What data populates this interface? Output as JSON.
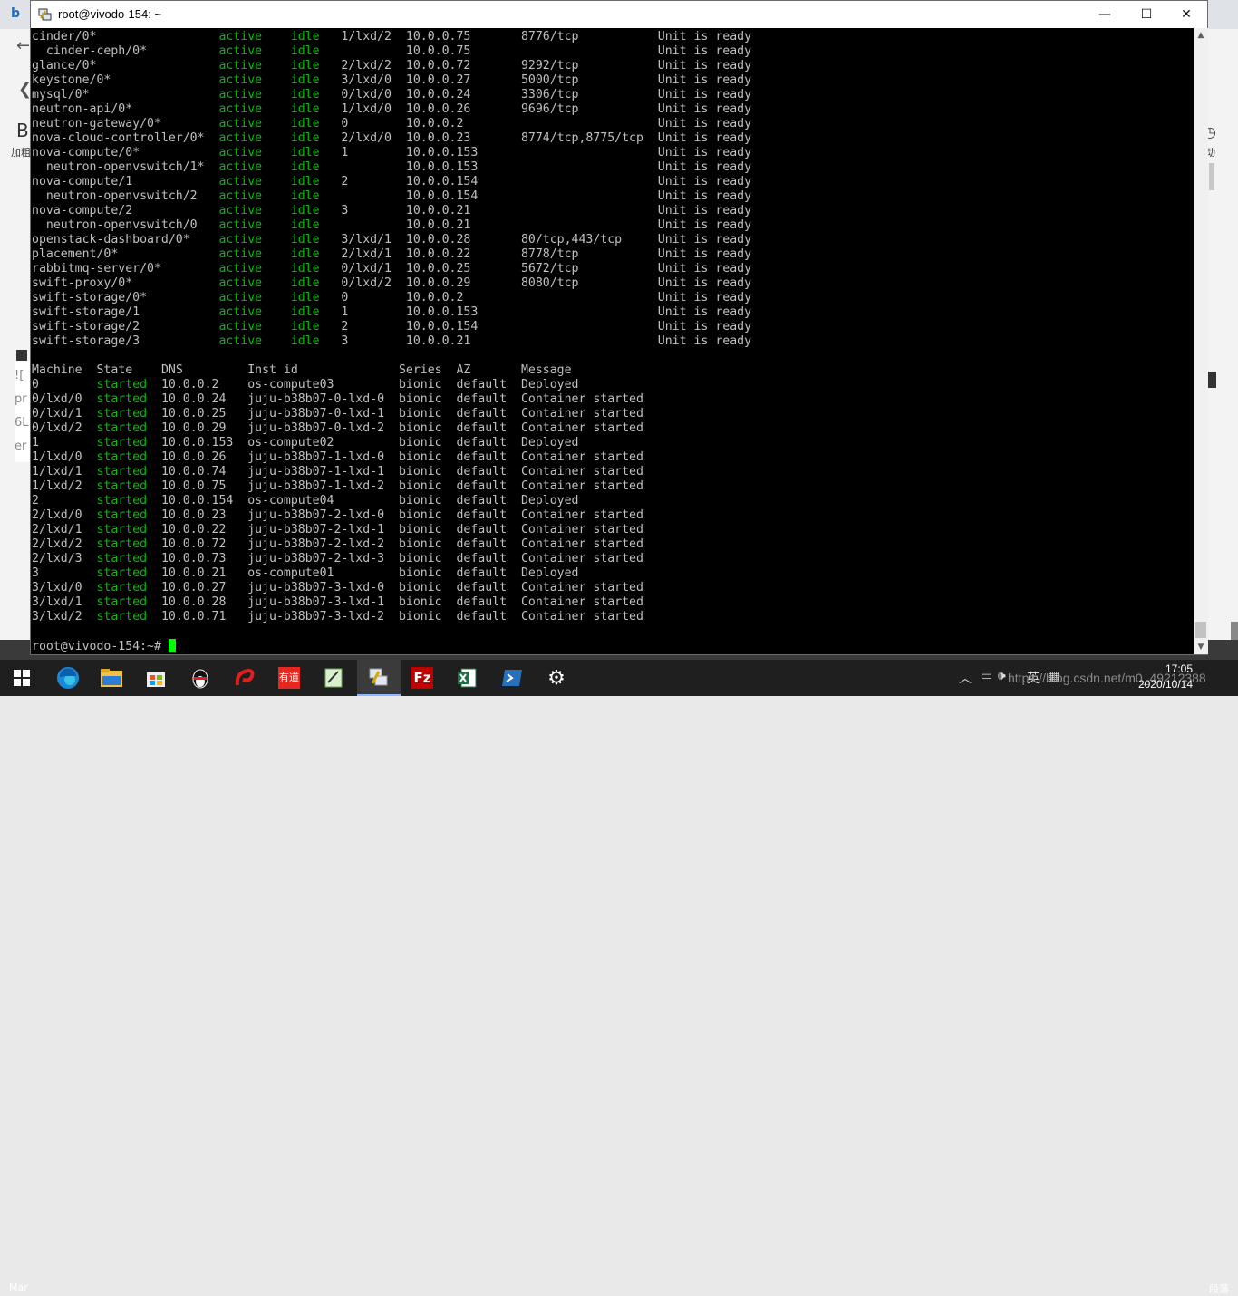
{
  "window": {
    "title": "root@vivodo-154: ~",
    "minimize_glyph": "—",
    "maximize_glyph": "☐",
    "close_glyph": "✕"
  },
  "background_browser": {
    "back_glyph": "←",
    "left_glyph": "❮",
    "letter": "B",
    "side_text": "加粗",
    "right_text": "动",
    "panel_lines": [
      "![",
      "pr",
      "6L",
      "er"
    ],
    "bottom_left": "Mar",
    "bottom_right": "段落"
  },
  "terminal": {
    "units": [
      [
        "cinder/0*",
        "active",
        "idle",
        "1/lxd/2",
        "10.0.0.75",
        "8776/tcp",
        "Unit is ready"
      ],
      [
        "  cinder-ceph/0*",
        "active",
        "idle",
        "",
        "10.0.0.75",
        "",
        "Unit is ready"
      ],
      [
        "glance/0*",
        "active",
        "idle",
        "2/lxd/2",
        "10.0.0.72",
        "9292/tcp",
        "Unit is ready"
      ],
      [
        "keystone/0*",
        "active",
        "idle",
        "3/lxd/0",
        "10.0.0.27",
        "5000/tcp",
        "Unit is ready"
      ],
      [
        "mysql/0*",
        "active",
        "idle",
        "0/lxd/0",
        "10.0.0.24",
        "3306/tcp",
        "Unit is ready"
      ],
      [
        "neutron-api/0*",
        "active",
        "idle",
        "1/lxd/0",
        "10.0.0.26",
        "9696/tcp",
        "Unit is ready"
      ],
      [
        "neutron-gateway/0*",
        "active",
        "idle",
        "0",
        "10.0.0.2",
        "",
        "Unit is ready"
      ],
      [
        "nova-cloud-controller/0*",
        "active",
        "idle",
        "2/lxd/0",
        "10.0.0.23",
        "8774/tcp,8775/tcp",
        "Unit is ready"
      ],
      [
        "nova-compute/0*",
        "active",
        "idle",
        "1",
        "10.0.0.153",
        "",
        "Unit is ready"
      ],
      [
        "  neutron-openvswitch/1*",
        "active",
        "idle",
        "",
        "10.0.0.153",
        "",
        "Unit is ready"
      ],
      [
        "nova-compute/1",
        "active",
        "idle",
        "2",
        "10.0.0.154",
        "",
        "Unit is ready"
      ],
      [
        "  neutron-openvswitch/2",
        "active",
        "idle",
        "",
        "10.0.0.154",
        "",
        "Unit is ready"
      ],
      [
        "nova-compute/2",
        "active",
        "idle",
        "3",
        "10.0.0.21",
        "",
        "Unit is ready"
      ],
      [
        "  neutron-openvswitch/0",
        "active",
        "idle",
        "",
        "10.0.0.21",
        "",
        "Unit is ready"
      ],
      [
        "openstack-dashboard/0*",
        "active",
        "idle",
        "3/lxd/1",
        "10.0.0.28",
        "80/tcp,443/tcp",
        "Unit is ready"
      ],
      [
        "placement/0*",
        "active",
        "idle",
        "2/lxd/1",
        "10.0.0.22",
        "8778/tcp",
        "Unit is ready"
      ],
      [
        "rabbitmq-server/0*",
        "active",
        "idle",
        "0/lxd/1",
        "10.0.0.25",
        "5672/tcp",
        "Unit is ready"
      ],
      [
        "swift-proxy/0*",
        "active",
        "idle",
        "0/lxd/2",
        "10.0.0.29",
        "8080/tcp",
        "Unit is ready"
      ],
      [
        "swift-storage/0*",
        "active",
        "idle",
        "0",
        "10.0.0.2",
        "",
        "Unit is ready"
      ],
      [
        "swift-storage/1",
        "active",
        "idle",
        "1",
        "10.0.0.153",
        "",
        "Unit is ready"
      ],
      [
        "swift-storage/2",
        "active",
        "idle",
        "2",
        "10.0.0.154",
        "",
        "Unit is ready"
      ],
      [
        "swift-storage/3",
        "active",
        "idle",
        "3",
        "10.0.0.21",
        "",
        "Unit is ready"
      ]
    ],
    "machine_headers": [
      "Machine",
      "State",
      "DNS",
      "Inst id",
      "Series",
      "AZ",
      "Message"
    ],
    "machines": [
      [
        "0",
        "started",
        "10.0.0.2",
        "os-compute03",
        "bionic",
        "default",
        "Deployed"
      ],
      [
        "0/lxd/0",
        "started",
        "10.0.0.24",
        "juju-b38b07-0-lxd-0",
        "bionic",
        "default",
        "Container started"
      ],
      [
        "0/lxd/1",
        "started",
        "10.0.0.25",
        "juju-b38b07-0-lxd-1",
        "bionic",
        "default",
        "Container started"
      ],
      [
        "0/lxd/2",
        "started",
        "10.0.0.29",
        "juju-b38b07-0-lxd-2",
        "bionic",
        "default",
        "Container started"
      ],
      [
        "1",
        "started",
        "10.0.0.153",
        "os-compute02",
        "bionic",
        "default",
        "Deployed"
      ],
      [
        "1/lxd/0",
        "started",
        "10.0.0.26",
        "juju-b38b07-1-lxd-0",
        "bionic",
        "default",
        "Container started"
      ],
      [
        "1/lxd/1",
        "started",
        "10.0.0.74",
        "juju-b38b07-1-lxd-1",
        "bionic",
        "default",
        "Container started"
      ],
      [
        "1/lxd/2",
        "started",
        "10.0.0.75",
        "juju-b38b07-1-lxd-2",
        "bionic",
        "default",
        "Container started"
      ],
      [
        "2",
        "started",
        "10.0.0.154",
        "os-compute04",
        "bionic",
        "default",
        "Deployed"
      ],
      [
        "2/lxd/0",
        "started",
        "10.0.0.23",
        "juju-b38b07-2-lxd-0",
        "bionic",
        "default",
        "Container started"
      ],
      [
        "2/lxd/1",
        "started",
        "10.0.0.22",
        "juju-b38b07-2-lxd-1",
        "bionic",
        "default",
        "Container started"
      ],
      [
        "2/lxd/2",
        "started",
        "10.0.0.72",
        "juju-b38b07-2-lxd-2",
        "bionic",
        "default",
        "Container started"
      ],
      [
        "2/lxd/3",
        "started",
        "10.0.0.73",
        "juju-b38b07-2-lxd-3",
        "bionic",
        "default",
        "Container started"
      ],
      [
        "3",
        "started",
        "10.0.0.21",
        "os-compute01",
        "bionic",
        "default",
        "Deployed"
      ],
      [
        "3/lxd/0",
        "started",
        "10.0.0.27",
        "juju-b38b07-3-lxd-0",
        "bionic",
        "default",
        "Container started"
      ],
      [
        "3/lxd/1",
        "started",
        "10.0.0.28",
        "juju-b38b07-3-lxd-1",
        "bionic",
        "default",
        "Container started"
      ],
      [
        "3/lxd/2",
        "started",
        "10.0.0.71",
        "juju-b38b07-3-lxd-2",
        "bionic",
        "default",
        "Container started"
      ]
    ],
    "prompt": "root@vivodo-154:~# ",
    "colors": {
      "text": "#c0c0c0",
      "status_green": "#00c000",
      "cursor": "#00ff00",
      "background": "#000000"
    }
  },
  "taskbar": {
    "items": [
      {
        "name": "start-button",
        "icon": "windows-logo-icon"
      },
      {
        "name": "edge-button",
        "icon": "edge-icon"
      },
      {
        "name": "file-explorer-button",
        "icon": "folder-icon"
      },
      {
        "name": "store-button",
        "icon": "store-icon"
      },
      {
        "name": "qq-button",
        "icon": "penguin-icon"
      },
      {
        "name": "app-red-button",
        "icon": "red-swirl-icon"
      },
      {
        "name": "youdao-button",
        "icon": "youdao-icon"
      },
      {
        "name": "notepad-button",
        "icon": "notepad-icon"
      },
      {
        "name": "putty-button",
        "icon": "putty-icon",
        "active": true
      },
      {
        "name": "filezilla-button",
        "icon": "filezilla-icon"
      },
      {
        "name": "excel-button",
        "icon": "excel-icon"
      },
      {
        "name": "powershell-button",
        "icon": "powershell-icon"
      },
      {
        "name": "settings-button",
        "icon": "gear-icon"
      }
    ],
    "youdao_label": "有道",
    "tray_chevron": "︿",
    "tray_lang": "英",
    "watermark": "https://blog.csdn.net/m0_49212388",
    "time": "17:05",
    "date": "2020/10/14"
  }
}
